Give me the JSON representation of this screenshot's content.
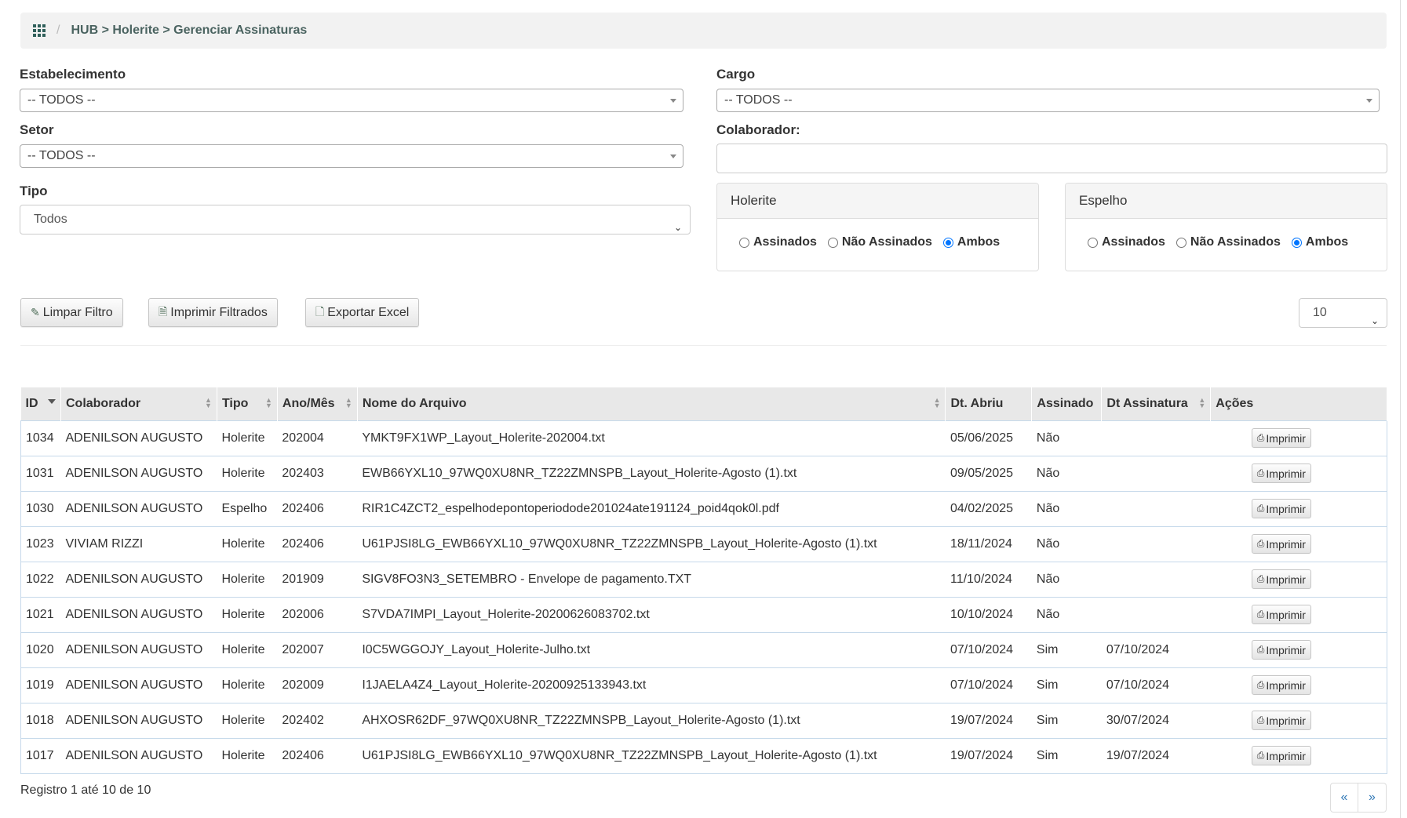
{
  "breadcrumb": {
    "path": "HUB > Holerite > Gerenciar Assinaturas"
  },
  "filters": {
    "estabelecimento_label": "Estabelecimento",
    "estabelecimento_value": "-- TODOS --",
    "setor_label": "Setor",
    "setor_value": "-- TODOS --",
    "tipo_label": "Tipo",
    "tipo_value": "Todos",
    "cargo_label": "Cargo",
    "cargo_value": "-- TODOS --",
    "colaborador_label": "Colaborador:",
    "colaborador_value": ""
  },
  "holerite_panel": {
    "title": "Holerite",
    "options": [
      "Assinados",
      "Não Assinados",
      "Ambos"
    ],
    "selected": "Ambos"
  },
  "espelho_panel": {
    "title": "Espelho",
    "options": [
      "Assinados",
      "Não Assinados",
      "Ambos"
    ],
    "selected": "Ambos"
  },
  "toolbar": {
    "limpar_label": "Limpar Filtro",
    "imprimir_label": "Imprimir Filtrados",
    "exportar_label": "Exportar Excel",
    "page_size": "10"
  },
  "table": {
    "headers": [
      "ID",
      "Colaborador",
      "Tipo",
      "Ano/Mês",
      "Nome do Arquivo",
      "Dt. Abriu",
      "Assinado",
      "Dt Assinatura",
      "Ações"
    ],
    "action_label": "Imprimir",
    "rows": [
      {
        "id": "1034",
        "colaborador": "ADENILSON AUGUSTO",
        "tipo": "Holerite",
        "anomes": "202004",
        "arquivo": "YMKT9FX1WP_Layout_Holerite-202004.txt",
        "abriu": "05/06/2025",
        "assinado": "Não",
        "dt_assinatura": ""
      },
      {
        "id": "1031",
        "colaborador": "ADENILSON AUGUSTO",
        "tipo": "Holerite",
        "anomes": "202403",
        "arquivo": "EWB66YXL10_97WQ0XU8NR_TZ22ZMNSPB_Layout_Holerite-Agosto (1).txt",
        "abriu": "09/05/2025",
        "assinado": "Não",
        "dt_assinatura": ""
      },
      {
        "id": "1030",
        "colaborador": "ADENILSON AUGUSTO",
        "tipo": "Espelho",
        "anomes": "202406",
        "arquivo": "RIR1C4ZCT2_espelhodepontoperiodode201024ate191124_poid4qok0l.pdf",
        "abriu": "04/02/2025",
        "assinado": "Não",
        "dt_assinatura": ""
      },
      {
        "id": "1023",
        "colaborador": "VIVIAM RIZZI",
        "tipo": "Holerite",
        "anomes": "202406",
        "arquivo": "U61PJSI8LG_EWB66YXL10_97WQ0XU8NR_TZ22ZMNSPB_Layout_Holerite-Agosto (1).txt",
        "abriu": "18/11/2024",
        "assinado": "Não",
        "dt_assinatura": ""
      },
      {
        "id": "1022",
        "colaborador": "ADENILSON AUGUSTO",
        "tipo": "Holerite",
        "anomes": "201909",
        "arquivo": "SIGV8FO3N3_SETEMBRO - Envelope de pagamento.TXT",
        "abriu": "11/10/2024",
        "assinado": "Não",
        "dt_assinatura": ""
      },
      {
        "id": "1021",
        "colaborador": "ADENILSON AUGUSTO",
        "tipo": "Holerite",
        "anomes": "202006",
        "arquivo": "S7VDA7IMPI_Layout_Holerite-20200626083702.txt",
        "abriu": "10/10/2024",
        "assinado": "Não",
        "dt_assinatura": ""
      },
      {
        "id": "1020",
        "colaborador": "ADENILSON AUGUSTO",
        "tipo": "Holerite",
        "anomes": "202007",
        "arquivo": "I0C5WGGOJY_Layout_Holerite-Julho.txt",
        "abriu": "07/10/2024",
        "assinado": "Sim",
        "dt_assinatura": "07/10/2024"
      },
      {
        "id": "1019",
        "colaborador": "ADENILSON AUGUSTO",
        "tipo": "Holerite",
        "anomes": "202009",
        "arquivo": "I1JAELA4Z4_Layout_Holerite-20200925133943.txt",
        "abriu": "07/10/2024",
        "assinado": "Sim",
        "dt_assinatura": "07/10/2024"
      },
      {
        "id": "1018",
        "colaborador": "ADENILSON AUGUSTO",
        "tipo": "Holerite",
        "anomes": "202402",
        "arquivo": "AHXOSR62DF_97WQ0XU8NR_TZ22ZMNSPB_Layout_Holerite-Agosto (1).txt",
        "abriu": "19/07/2024",
        "assinado": "Sim",
        "dt_assinatura": "30/07/2024"
      },
      {
        "id": "1017",
        "colaborador": "ADENILSON AUGUSTO",
        "tipo": "Holerite",
        "anomes": "202406",
        "arquivo": "U61PJSI8LG_EWB66YXL10_97WQ0XU8NR_TZ22ZMNSPB_Layout_Holerite-Agosto (1).txt",
        "abriu": "19/07/2024",
        "assinado": "Sim",
        "dt_assinatura": "19/07/2024"
      }
    ]
  },
  "footer": {
    "info": "Registro 1 até 10 de 10",
    "prev": "«",
    "next": "»"
  }
}
